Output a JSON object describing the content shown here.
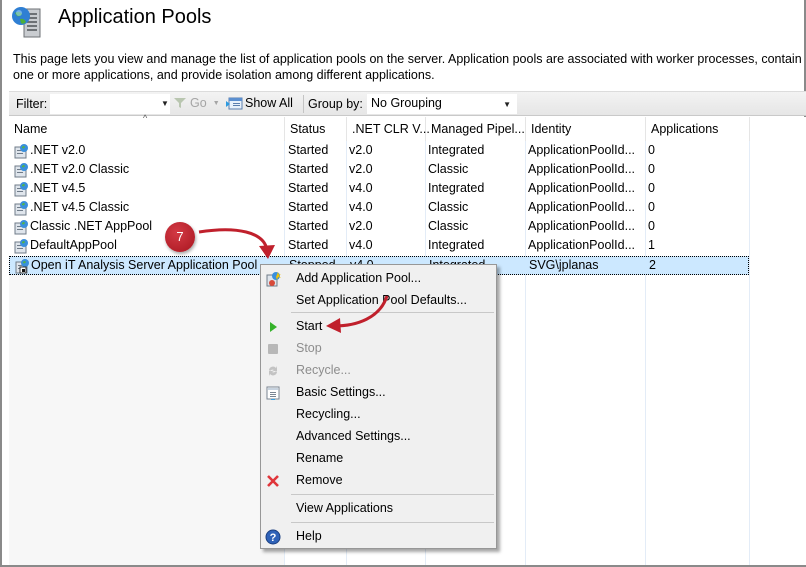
{
  "page": {
    "title": "Application Pools",
    "description": "This page lets you view and manage the list of application pools on the server. Application pools are associated with worker processes, contain one or more applications, and provide isolation among different applications."
  },
  "toolbar": {
    "filter_label": "Filter:",
    "filter_value": "",
    "go_label": "Go",
    "show_all_label": "Show All",
    "group_by_label": "Group by:",
    "group_by_value": "No Grouping"
  },
  "grid": {
    "columns": [
      "Name",
      "Status",
      ".NET CLR V...",
      "Managed Pipel...",
      "Identity",
      "Applications"
    ],
    "sorted_column": "Name",
    "rows": [
      {
        "name": ".NET v2.0",
        "status": "Started",
        "clr": "v2.0",
        "pipeline": "Integrated",
        "identity": "ApplicationPoolId...",
        "applications": "0"
      },
      {
        "name": ".NET v2.0 Classic",
        "status": "Started",
        "clr": "v2.0",
        "pipeline": "Classic",
        "identity": "ApplicationPoolId...",
        "applications": "0"
      },
      {
        "name": ".NET v4.5",
        "status": "Started",
        "clr": "v4.0",
        "pipeline": "Integrated",
        "identity": "ApplicationPoolId...",
        "applications": "0"
      },
      {
        "name": ".NET v4.5 Classic",
        "status": "Started",
        "clr": "v4.0",
        "pipeline": "Classic",
        "identity": "ApplicationPoolId...",
        "applications": "0"
      },
      {
        "name": "Classic .NET AppPool",
        "status": "Started",
        "clr": "v2.0",
        "pipeline": "Classic",
        "identity": "ApplicationPoolId...",
        "applications": "0"
      },
      {
        "name": "DefaultAppPool",
        "status": "Started",
        "clr": "v4.0",
        "pipeline": "Integrated",
        "identity": "ApplicationPoolId...",
        "applications": "1"
      },
      {
        "name": "Open iT Analysis Server Application Pool",
        "status": "Stopped",
        "clr": "v4.0",
        "pipeline": "Integrated",
        "identity": "SVG\\jplanas",
        "applications": "2",
        "selected": true
      }
    ]
  },
  "context_menu": {
    "items": [
      {
        "label": "Add Application Pool...",
        "icon": "add-pool-icon",
        "enabled": true
      },
      {
        "label": "Set Application Pool Defaults...",
        "icon": "",
        "enabled": true
      },
      {
        "label": "Start",
        "icon": "play-icon",
        "enabled": true
      },
      {
        "label": "Stop",
        "icon": "stop-icon",
        "enabled": false
      },
      {
        "label": "Recycle...",
        "icon": "recycle-icon",
        "enabled": false
      },
      {
        "label": "Basic Settings...",
        "icon": "settings-sheet-icon",
        "enabled": true
      },
      {
        "label": "Recycling...",
        "icon": "",
        "enabled": true
      },
      {
        "label": "Advanced Settings...",
        "icon": "",
        "enabled": true
      },
      {
        "label": "Rename",
        "icon": "",
        "enabled": true
      },
      {
        "label": "Remove",
        "icon": "remove-x-icon",
        "enabled": true
      },
      {
        "label": "View Applications",
        "icon": "",
        "enabled": true
      },
      {
        "label": "Help",
        "icon": "help-icon",
        "enabled": true
      }
    ]
  },
  "annotation": {
    "step_number": "7",
    "color": "#c0202c"
  },
  "colors": {
    "selection": "#cce8ff",
    "menu_background": "#f0f0f0",
    "annotation_red": "#c0202c"
  }
}
